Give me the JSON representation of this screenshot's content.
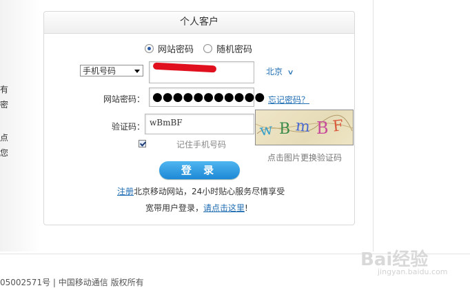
{
  "left_fragments": [
    "有",
    "密",
    "点",
    "您"
  ],
  "panel": {
    "title": "个人客户",
    "radio_site": "网站密码",
    "radio_random": "随机密码",
    "account_type": "手机号码",
    "city": "北京",
    "password_label": "网站密码：",
    "password_mask": "●●●●●●●●●●●",
    "forgot": "忘记密码？",
    "captcha_label": "验证码：",
    "captcha_value": "wBmBF",
    "captcha_image_text": "wBmBF",
    "captcha_caption": "点击图片更换验证码",
    "remember": "记住手机号码",
    "login": "登 录",
    "register_link": "注册",
    "register_text": "北京移动网站，24小时贴心服务尽情享受",
    "broadband_text": "宽带用户登录，",
    "broadband_link": "请点击这里",
    "broadband_tail": "!"
  },
  "footer": "05002571号 | 中国移动通信 版权所有",
  "watermark": {
    "brand": "Bai经验",
    "url": "jingyan.baidu.com"
  },
  "colors": {
    "link": "#1f6db3",
    "button": "#1d88d6",
    "redaction": "#e0101e"
  }
}
